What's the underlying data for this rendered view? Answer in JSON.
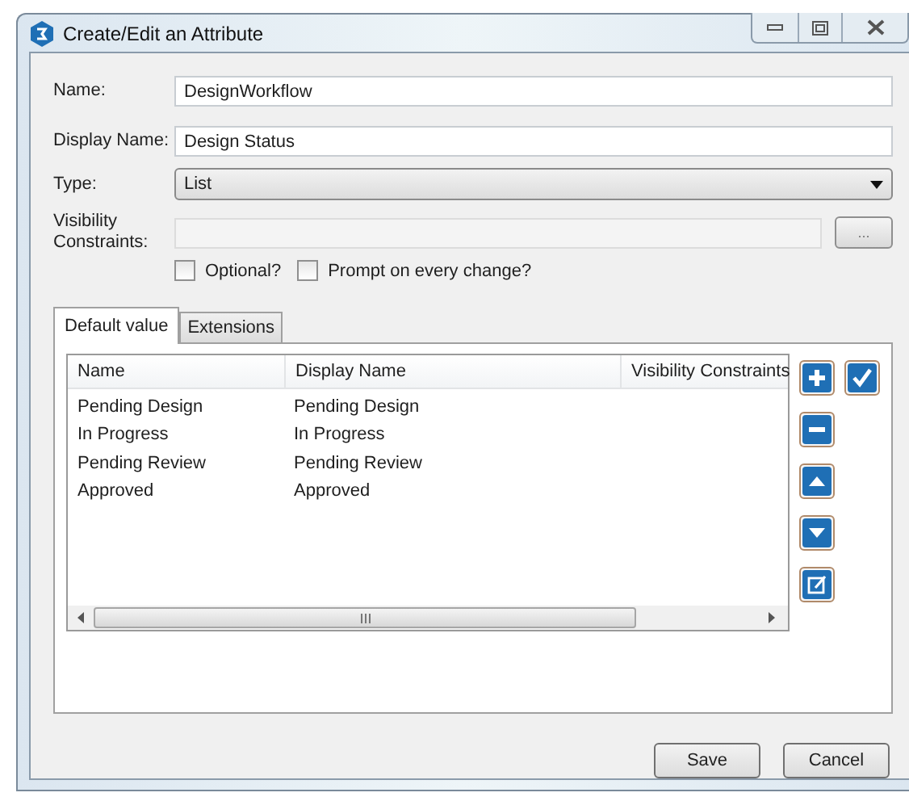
{
  "window": {
    "title": "Create/Edit an Attribute"
  },
  "fields": [
    {
      "label": "Name:",
      "value": "DesignWorkflow",
      "kind": "text"
    },
    {
      "label": "Display Name:",
      "value": "Design Status",
      "kind": "text"
    },
    {
      "label": "Type:",
      "value": "List",
      "kind": "select"
    }
  ],
  "visibility": {
    "label": "Visibility Constraints:",
    "disabled": true,
    "button": "..."
  },
  "checkboxes": [
    {
      "label": "Optional?",
      "checked": false
    },
    {
      "label": "Prompt on every change?",
      "checked": false
    }
  ],
  "tabs": [
    {
      "label": "Default value",
      "selected": true
    },
    {
      "label": "Extensions",
      "selected": false
    }
  ],
  "table": {
    "columns": [
      "Name",
      "Display Name",
      "Visibility Constraints"
    ],
    "rows": [
      [
        "Pending Design",
        "Pending Design",
        ""
      ],
      [
        "In Progress",
        "In Progress",
        ""
      ],
      [
        "Pending Review",
        "Pending Review",
        ""
      ],
      [
        "Approved",
        "Approved",
        ""
      ]
    ]
  },
  "buttons": [
    "Save",
    "Cancel"
  ]
}
